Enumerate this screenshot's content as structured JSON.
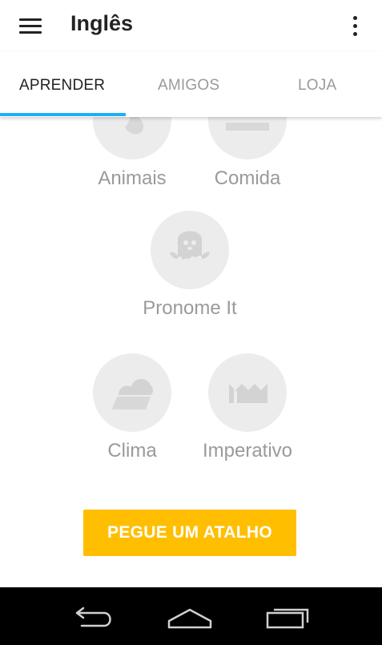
{
  "appbar": {
    "title": "Inglês",
    "menu_icon": "hamburger-menu-icon",
    "more_icon": "vertical-dots-icon"
  },
  "tabs": [
    {
      "label": "APRENDER",
      "active": true
    },
    {
      "label": "AMIGOS",
      "active": false
    },
    {
      "label": "LOJA",
      "active": false
    }
  ],
  "skills": [
    {
      "label": "Animais",
      "icon": "animal-icon"
    },
    {
      "label": "Comida",
      "icon": "food-icon"
    },
    {
      "label": "Pronome It",
      "icon": "ghost-icon"
    },
    {
      "label": "Clima",
      "icon": "cloud-icon"
    },
    {
      "label": "Imperativo",
      "icon": "crown-icon"
    }
  ],
  "cta": {
    "label": "PEGUE UM ATALHO",
    "color": "#ffbf00"
  },
  "colors": {
    "accent": "#1cb0f6",
    "skill_bg": "#ececec",
    "skill_text": "#9a9a9a"
  },
  "navbar": {
    "back_icon": "back-icon",
    "home_icon": "home-icon",
    "recents_icon": "recent-apps-icon"
  }
}
